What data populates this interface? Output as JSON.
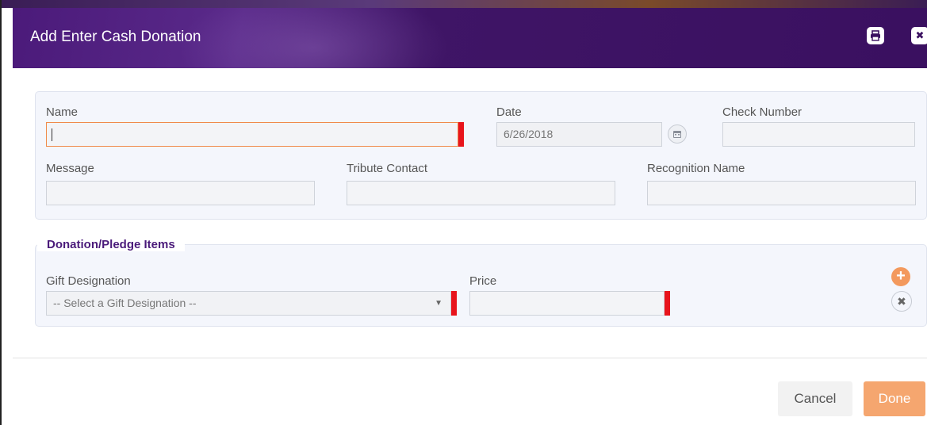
{
  "dialog": {
    "title": "Add Enter Cash Donation"
  },
  "header_icons": {
    "print": "print-icon",
    "close": "close-icon"
  },
  "form": {
    "name": {
      "label": "Name",
      "value": ""
    },
    "date": {
      "label": "Date",
      "value": "6/26/2018"
    },
    "check_number": {
      "label": "Check Number",
      "value": ""
    },
    "message": {
      "label": "Message",
      "value": ""
    },
    "tribute_contact": {
      "label": "Tribute Contact",
      "value": ""
    },
    "recognition_name": {
      "label": "Recognition Name",
      "value": ""
    }
  },
  "items_section": {
    "title": "Donation/Pledge Items",
    "gift_designation": {
      "label": "Gift Designation",
      "selected": "-- Select a Gift Designation --"
    },
    "price": {
      "label": "Price",
      "value": ""
    },
    "add_icon": "plus-circle-icon",
    "remove_icon": "x-circle-icon"
  },
  "footer": {
    "cancel_label": "Cancel",
    "done_label": "Done"
  },
  "colors": {
    "header_purple": "#3f1566",
    "accent_orange": "#f3995d",
    "required_red": "#e8141c",
    "section_title_purple": "#4a1a7a"
  }
}
